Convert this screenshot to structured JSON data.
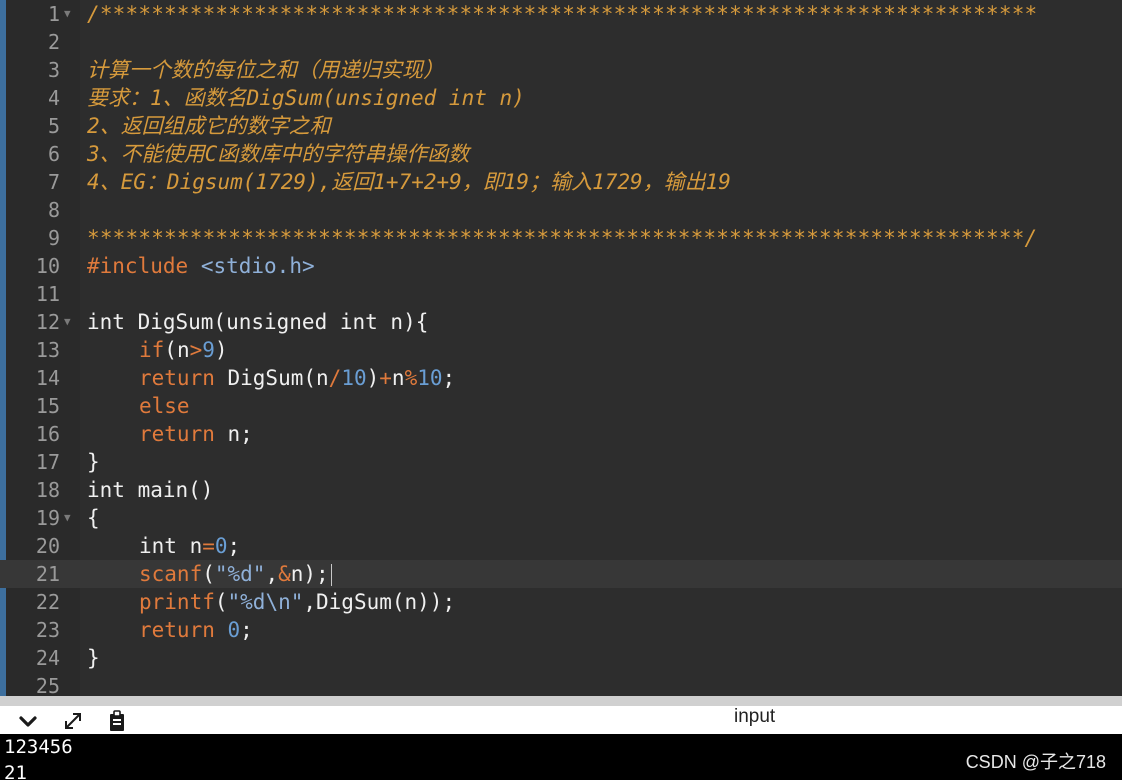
{
  "editor": {
    "line_numbers": [
      "1",
      "2",
      "3",
      "4",
      "5",
      "6",
      "7",
      "8",
      "9",
      "10",
      "11",
      "12",
      "13",
      "14",
      "15",
      "16",
      "17",
      "18",
      "19",
      "20",
      "21",
      "22",
      "23",
      "24",
      "25"
    ],
    "lines": {
      "l1": "/*************************************************************************",
      "l3": "计算一个数的每位之和（用递归实现）",
      "l4": "要求：1、函数名DigSum(unsigned int n)",
      "l5": "2、返回组成它的数字之和",
      "l6": "3、不能使用C函数库中的字符串操作函数",
      "l7": "4、EG：Digsum(1729),返回1+7+2+9，即19；输入1729，输出19",
      "l9": "*************************************************************************/",
      "l10_directive": "#include",
      "l10_path": "<stdio.h>",
      "l12": "int DigSum(unsigned int n){",
      "l13_kw": "if",
      "l13_a": "(n",
      "l13_op": ">",
      "l13_num": "9",
      "l13_b": ")",
      "l14_kw": "return",
      "l14_a": " DigSum(n",
      "l14_op1": "/",
      "l14_num1": "10",
      "l14_b": ")",
      "l14_op2": "+",
      "l14_c": "n",
      "l14_op3": "%",
      "l14_num2": "10",
      "l14_d": ";",
      "l15_kw": "else",
      "l16_kw": "return",
      "l16_a": " n;",
      "l17": "}",
      "l18": "int main()",
      "l19": "{",
      "l20_a": "int n",
      "l20_op": "=",
      "l20_num": "0",
      "l20_b": ";",
      "l21_fn": "scanf",
      "l21_a": "(",
      "l21_str": "\"%d\"",
      "l21_b": ",",
      "l21_op": "&",
      "l21_c": "n);",
      "l22_fn": "printf",
      "l22_a": "(",
      "l22_str": "\"%d\\n\"",
      "l22_b": ",DigSum(n));",
      "l23_kw": "return",
      "l23_num": "0",
      "l23_b": ";",
      "l24": "}"
    }
  },
  "panel": {
    "title": "input",
    "icons": [
      "chevron-down-icon",
      "expand-icon",
      "clipboard-icon"
    ]
  },
  "console": {
    "input_line": "123456",
    "output_line": "21"
  },
  "watermark": "CSDN @子之718",
  "colors": {
    "background": "#2d2d2d",
    "comment": "#d69a3c",
    "keyword": "#e07a3c",
    "number": "#6a9ed4",
    "string": "#8fb0d8"
  }
}
